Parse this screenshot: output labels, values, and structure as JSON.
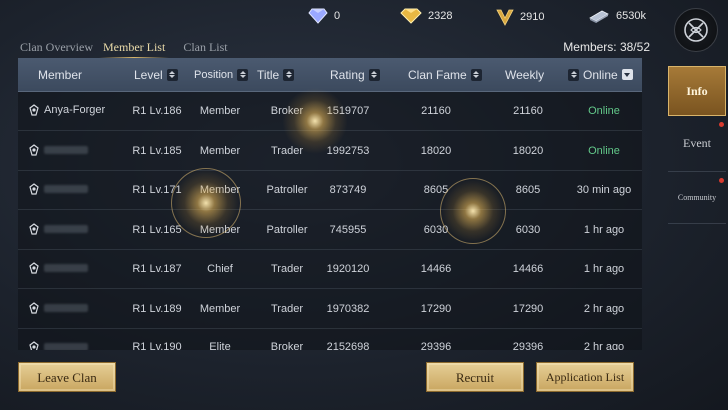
{
  "resources": [
    {
      "icon": "diamond-icon",
      "value": "0"
    },
    {
      "icon": "gold-gem-icon",
      "value": "2328"
    },
    {
      "icon": "v-coin-icon",
      "value": "2910"
    },
    {
      "icon": "silver-bar-icon",
      "value": "6530k"
    }
  ],
  "tabs": [
    "Clan Overview",
    "Member List",
    "Clan List"
  ],
  "members_count": "Members: 38/52",
  "columns": {
    "member": "Member",
    "level": "Level",
    "position": "Position",
    "title": "Title",
    "rating": "Rating",
    "clan_fame": "Clan Fame",
    "weekly": "Weekly",
    "online": "Online"
  },
  "rows": [
    {
      "name": "Anya-Forger",
      "level": "R1 Lv.186",
      "position": "Member",
      "title": "Broker",
      "rating": "1519707",
      "fame": "21160",
      "weekly": "21160",
      "online": "Online"
    },
    {
      "name": "",
      "level": "R1 Lv.185",
      "position": "Member",
      "title": "Trader",
      "rating": "1992753",
      "fame": "18020",
      "weekly": "18020",
      "online": "Online"
    },
    {
      "name": "",
      "level": "R1 Lv.171",
      "position": "Member",
      "title": "Patroller",
      "rating": "873749",
      "fame": "8605",
      "weekly": "8605",
      "online": "30 min ago"
    },
    {
      "name": "",
      "level": "R1 Lv.165",
      "position": "Member",
      "title": "Patroller",
      "rating": "745955",
      "fame": "6030",
      "weekly": "6030",
      "online": "1 hr ago"
    },
    {
      "name": "",
      "level": "R1 Lv.187",
      "position": "Chief",
      "title": "Trader",
      "rating": "1920120",
      "fame": "14466",
      "weekly": "14466",
      "online": "1 hr ago"
    },
    {
      "name": "",
      "level": "R1 Lv.189",
      "position": "Member",
      "title": "Trader",
      "rating": "1970382",
      "fame": "17290",
      "weekly": "17290",
      "online": "2 hr ago"
    },
    {
      "name": "",
      "level": "R1 Lv.190",
      "position": "Elite",
      "title": "Broker",
      "rating": "2152698",
      "fame": "29396",
      "weekly": "29396",
      "online": "2 hr ago"
    }
  ],
  "sidebar": {
    "info": "Info",
    "event": "Event",
    "community": "Community"
  },
  "buttons": {
    "leave": "Leave Clan",
    "recruit": "Recruit",
    "application": "Application List"
  },
  "colors": {
    "accent_gold": "#d6b56a",
    "online_green": "#63c98a",
    "header_bg": "#4b5a70"
  }
}
